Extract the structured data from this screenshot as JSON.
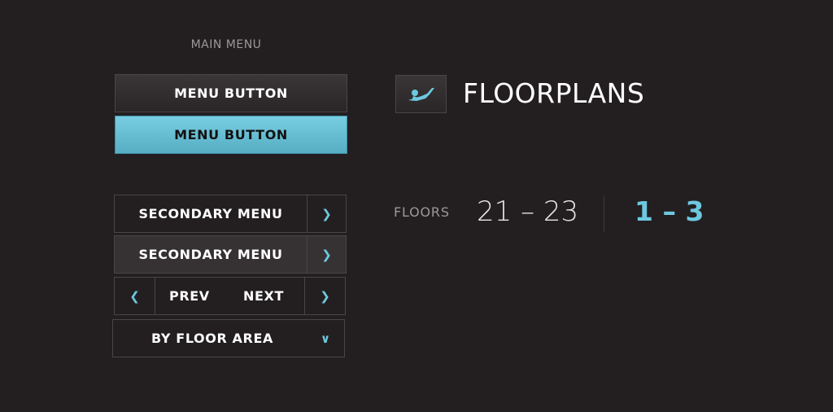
{
  "main_menu": {
    "title": "MAIN MENU",
    "buttons": [
      {
        "label": "MENU BUTTON",
        "state": "default"
      },
      {
        "label": "MENU BUTTON",
        "state": "active"
      }
    ]
  },
  "secondary_menu": [
    {
      "label": "SECONDARY MENU",
      "arrow": "chevron-right-icon"
    },
    {
      "label": "SECONDARY MENU",
      "arrow": "chevron-right-icon",
      "state": "hover"
    }
  ],
  "pager": {
    "prev_label": "PREV",
    "next_label": "NEXT",
    "prev_icon": "chevron-left-icon",
    "next_icon": "chevron-right-icon"
  },
  "dropdown": {
    "selected": "BY FLOOR AREA",
    "icon": "chevron-down-icon"
  },
  "header": {
    "icon": "floorplans-figure-icon",
    "title": "FLOORPLANS"
  },
  "floors": {
    "label": "FLOORS",
    "range_a": "21 – 23",
    "range_b": "1 – 3"
  },
  "colors": {
    "background": "#231f20",
    "accent": "#6dc8e0",
    "border": "#4a4647",
    "muted_text": "#9b9899"
  }
}
